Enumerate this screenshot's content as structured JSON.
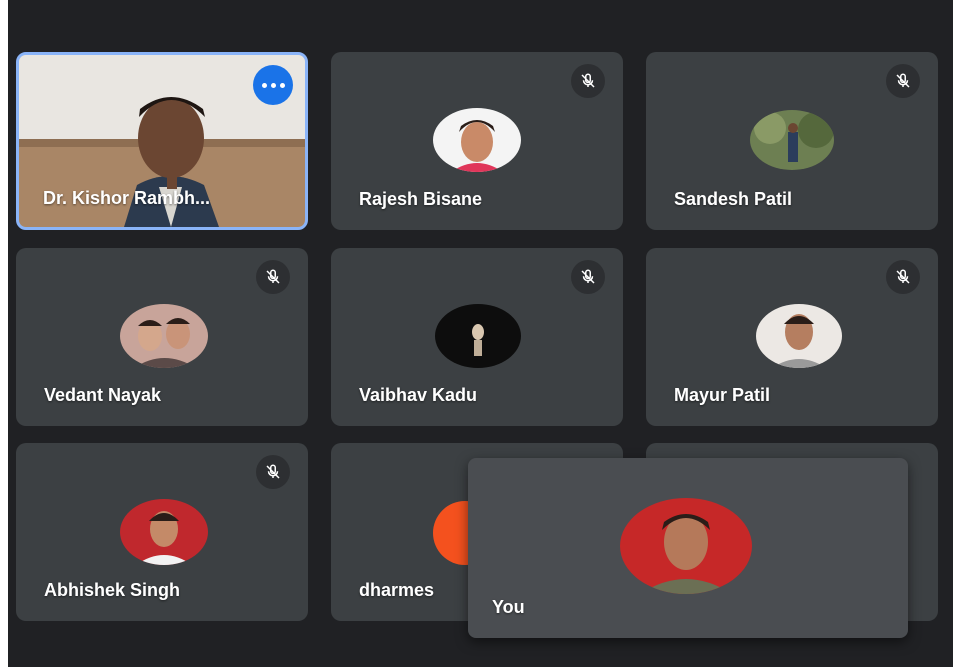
{
  "participants": [
    {
      "name": "Dr. Kishor Rambh...",
      "speaking": true,
      "muted": false,
      "video": true
    },
    {
      "name": "Rajesh Bisane",
      "muted": true
    },
    {
      "name": "Sandesh Patil",
      "muted": true
    },
    {
      "name": "Vedant Nayak",
      "muted": true
    },
    {
      "name": "Vaibhav Kadu",
      "muted": true
    },
    {
      "name": "Mayur Patil",
      "muted": true
    },
    {
      "name": "Abhishek Singh",
      "muted": true
    },
    {
      "name": "dharmes",
      "muted": true
    }
  ],
  "self_view": {
    "label": "You"
  },
  "colors": {
    "background": "#202124",
    "tile": "#3c4043",
    "active_border": "#8ab4f8",
    "more_button": "#1a73e8"
  },
  "icons": {
    "mic_off": "mic-off-icon",
    "more": "more-options-icon"
  }
}
